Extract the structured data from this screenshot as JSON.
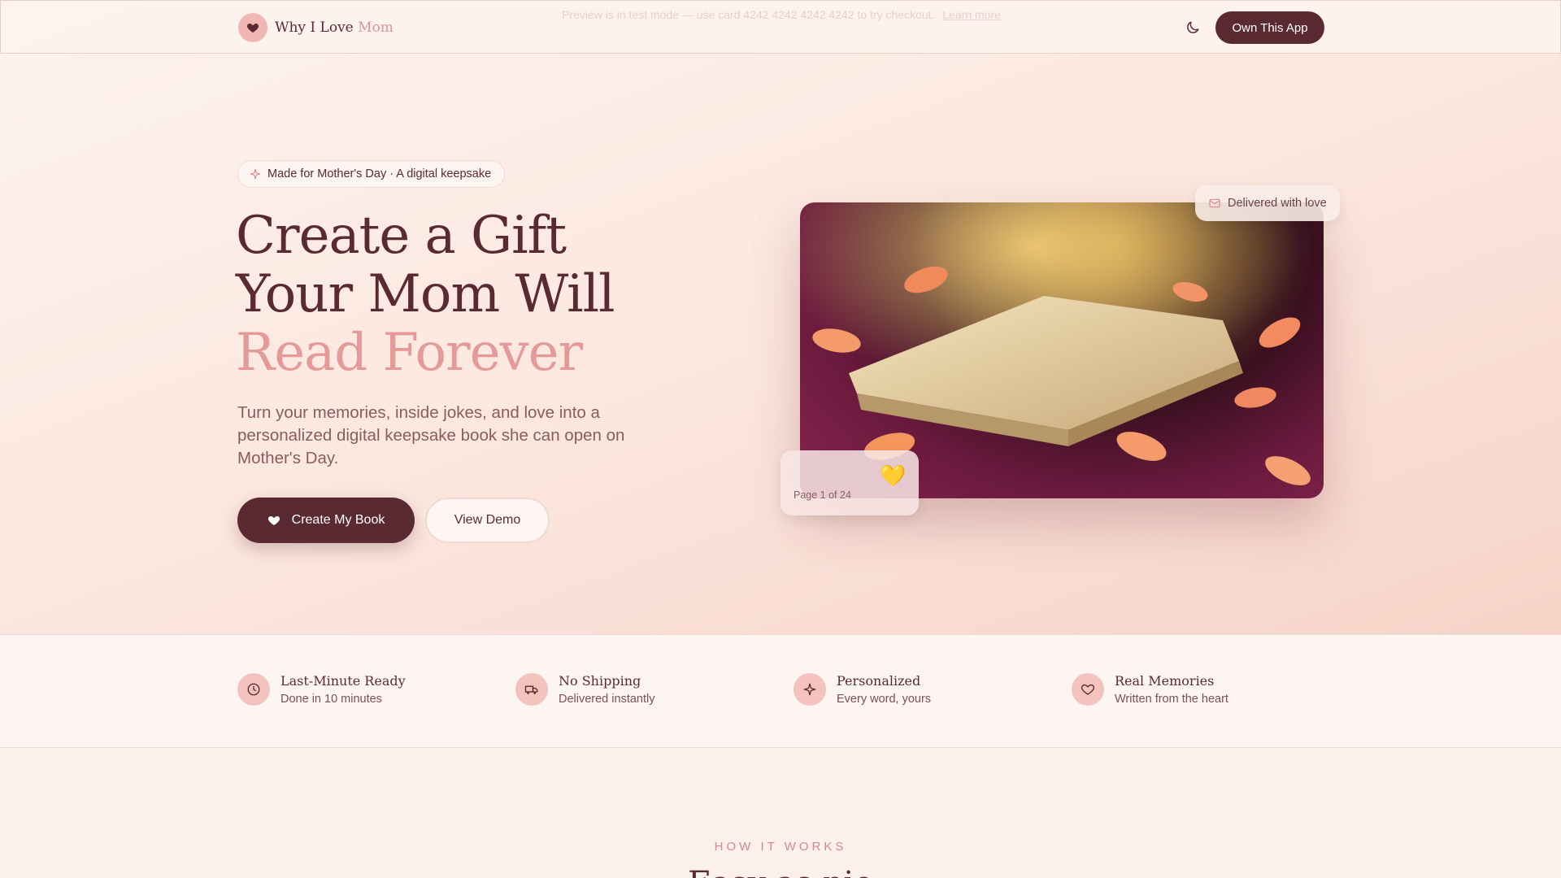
{
  "topbar": {
    "preview_notice": "Preview is in test mode — use card 4242 4242 4242 4242 to try checkout.",
    "learn_more": "Learn more",
    "logo_text_main": "Why I Love",
    "logo_text_accent": "Mom",
    "own_app_label": "Own This App"
  },
  "hero": {
    "tagline": "Made for Mother's Day · A digital keepsake",
    "headline_line1": "Create a Gift",
    "headline_line2": "Your Mom Will",
    "headline_line3": "Read Forever",
    "subtext": "Turn your memories, inside jokes, and love into a personalized digital keepsake book she can open on Mother's Day.",
    "primary_cta": "Create My Book",
    "secondary_cta": "View Demo",
    "delivered_badge": "Delivered with love",
    "page_card_emoji": "💛",
    "page_card_label": "Page 1 of 24"
  },
  "features": [
    {
      "title": "Last-Minute Ready",
      "subtitle": "Done in 10 minutes",
      "icon": "clock-icon"
    },
    {
      "title": "No Shipping",
      "subtitle": "Delivered instantly",
      "icon": "truck-icon"
    },
    {
      "title": "Personalized",
      "subtitle": "Every word, yours",
      "icon": "sparkle-icon"
    },
    {
      "title": "Real Memories",
      "subtitle": "Written from the heart",
      "icon": "heart-icon"
    }
  ],
  "how_it_works": {
    "label": "HOW IT WORKS",
    "title": "Easy as pie"
  },
  "colors": {
    "brand_dark": "#5a2a32",
    "accent_pink": "#e39a98",
    "icon_bg": "#f4c3bd"
  }
}
